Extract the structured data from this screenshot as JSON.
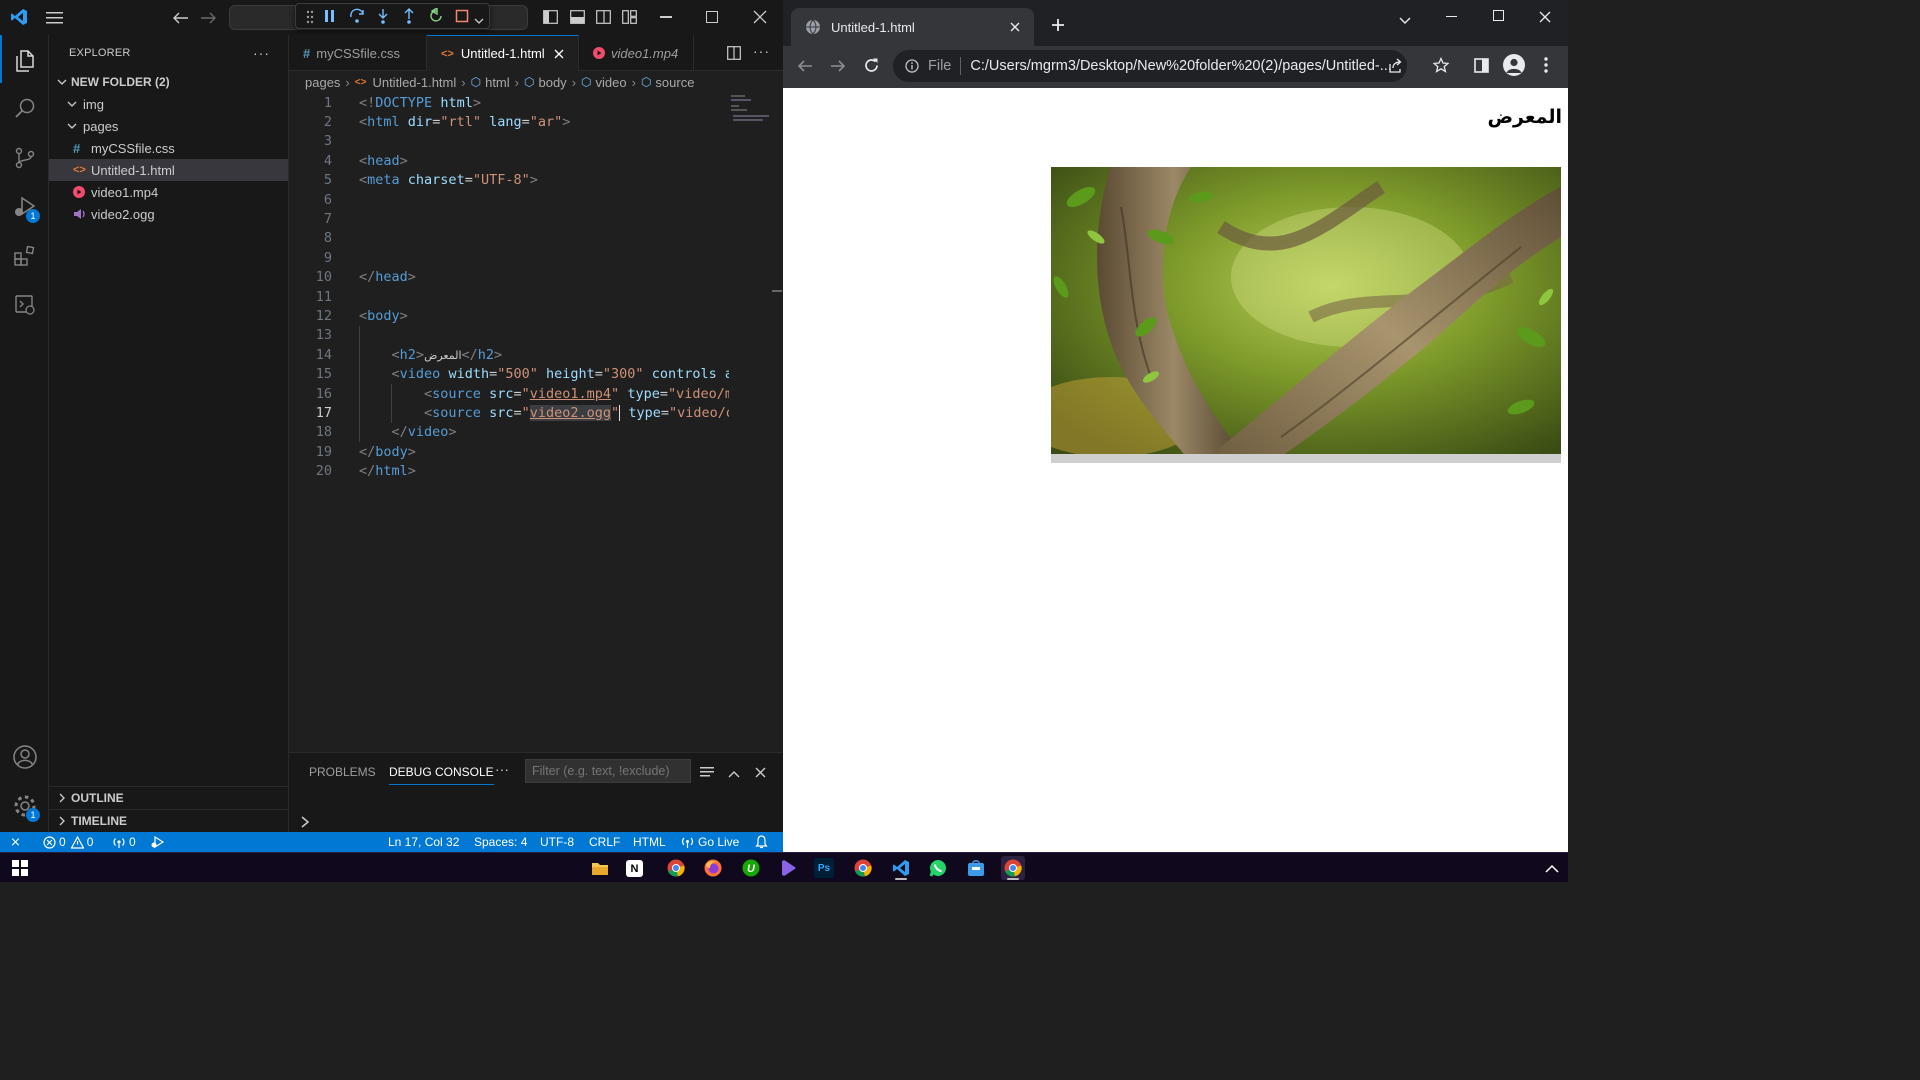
{
  "vscode": {
    "explorer_title": "EXPLORER",
    "folder_name": "NEW FOLDER (2)",
    "tree": [
      {
        "label": "img",
        "kind": "folder"
      },
      {
        "label": "pages",
        "kind": "folder"
      },
      {
        "label": "myCSSfile.css",
        "kind": "css"
      },
      {
        "label": "Untitled-1.html",
        "kind": "html"
      },
      {
        "label": "video1.mp4",
        "kind": "video"
      },
      {
        "label": "video2.ogg",
        "kind": "audio"
      }
    ],
    "outline": "OUTLINE",
    "timeline": "TIMELINE",
    "tabs": [
      {
        "label": "myCSSfile.css"
      },
      {
        "label": "Untitled-1.html"
      },
      {
        "label": "video1.mp4"
      }
    ],
    "breadcrumbs": [
      "pages",
      "Untitled-1.html",
      "html",
      "body",
      "video",
      "source"
    ],
    "code_lines": [
      {
        "n": "1"
      },
      {
        "n": "2"
      },
      {
        "n": "3"
      },
      {
        "n": "4"
      },
      {
        "n": "5"
      },
      {
        "n": "6"
      },
      {
        "n": "7"
      },
      {
        "n": "8"
      },
      {
        "n": "9"
      },
      {
        "n": "10"
      },
      {
        "n": "11"
      },
      {
        "n": "12"
      },
      {
        "n": "13"
      },
      {
        "n": "14"
      },
      {
        "n": "15"
      },
      {
        "n": "16"
      },
      {
        "n": "17"
      },
      {
        "n": "18"
      },
      {
        "n": "19"
      },
      {
        "n": "20"
      }
    ],
    "panel_tabs": [
      "PROBLEMS",
      "DEBUG CONSOLE"
    ],
    "filter_placeholder": "Filter (e.g. text, !exclude)",
    "status": {
      "errors": "0",
      "warnings": "0",
      "ports": "0",
      "position": "Ln 17, Col 32",
      "spaces": "Spaces: 4",
      "encoding": "UTF-8",
      "eol": "CRLF",
      "language": "HTML",
      "golive": "Go Live"
    },
    "badge_debug": "1",
    "badge_settings": "1"
  },
  "chrome": {
    "tab_title": "Untitled-1.html",
    "scheme_label": "File",
    "url": "C:/Users/mgrm3/Desktop/New%20folder%20(2)/pages/Untitled-...",
    "heading": "المعرض"
  },
  "colors": {
    "accent": "#0078d4",
    "status_bar": "#0078d4",
    "chrome_dark": "#35363a"
  }
}
